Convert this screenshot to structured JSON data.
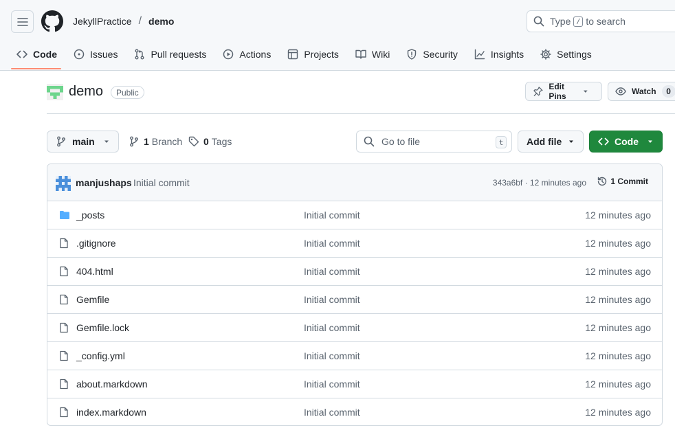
{
  "header": {
    "owner": "JekyllPractice",
    "separator": "/",
    "repo": "demo",
    "search_prefix": "Type",
    "search_key": "/",
    "search_suffix": "to search"
  },
  "tabs": [
    {
      "label": "Code",
      "icon": "code-icon"
    },
    {
      "label": "Issues",
      "icon": "issue-icon"
    },
    {
      "label": "Pull requests",
      "icon": "pull-request-icon"
    },
    {
      "label": "Actions",
      "icon": "play-icon"
    },
    {
      "label": "Projects",
      "icon": "table-icon"
    },
    {
      "label": "Wiki",
      "icon": "book-icon"
    },
    {
      "label": "Security",
      "icon": "shield-icon"
    },
    {
      "label": "Insights",
      "icon": "graph-icon"
    },
    {
      "label": "Settings",
      "icon": "gear-icon"
    }
  ],
  "repo": {
    "name": "demo",
    "visibility": "Public",
    "edit_pins": "Edit Pins",
    "watch": "Watch",
    "watch_count": "0"
  },
  "branchbar": {
    "branch": "main",
    "branches_count": "1",
    "branches_label": "Branch",
    "tags_count": "0",
    "tags_label": "Tags",
    "goto_placeholder": "Go to file",
    "goto_key": "t",
    "add_file": "Add file",
    "code": "Code"
  },
  "commit": {
    "author": "manjushaps",
    "message": "Initial commit",
    "meta": "343a6bf · 12 minutes ago",
    "count_label": "1 Commit"
  },
  "files": [
    {
      "name": "_posts",
      "type": "folder",
      "message": "Initial commit",
      "time": "12 minutes ago"
    },
    {
      "name": ".gitignore",
      "type": "file",
      "message": "Initial commit",
      "time": "12 minutes ago"
    },
    {
      "name": "404.html",
      "type": "file",
      "message": "Initial commit",
      "time": "12 minutes ago"
    },
    {
      "name": "Gemfile",
      "type": "file",
      "message": "Initial commit",
      "time": "12 minutes ago"
    },
    {
      "name": "Gemfile.lock",
      "type": "file",
      "message": "Initial commit",
      "time": "12 minutes ago"
    },
    {
      "name": "_config.yml",
      "type": "file",
      "message": "Initial commit",
      "time": "12 minutes ago"
    },
    {
      "name": "about.markdown",
      "type": "file",
      "message": "Initial commit",
      "time": "12 minutes ago"
    },
    {
      "name": "index.markdown",
      "type": "file",
      "message": "Initial commit",
      "time": "12 minutes ago"
    }
  ],
  "colors": {
    "accent_underline": "#fd8c73",
    "primary_button": "#1f883d",
    "folder_icon": "#54aeff",
    "border": "#d1d9e0"
  }
}
